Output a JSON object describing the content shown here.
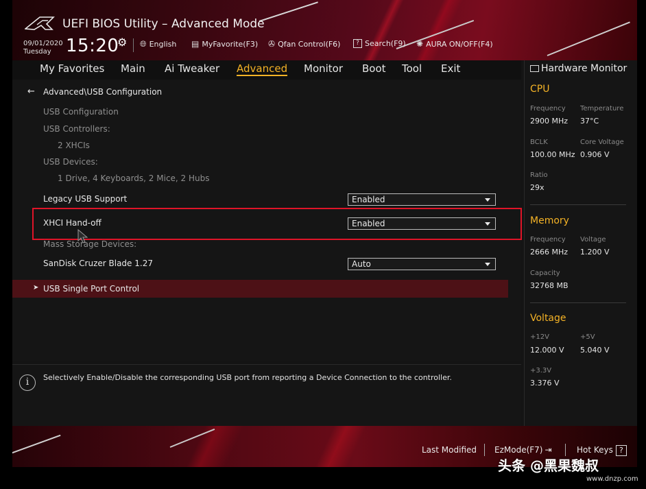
{
  "header": {
    "title": "UEFI BIOS Utility – Advanced Mode",
    "date": "09/01/2020",
    "day": "Tuesday",
    "time": "15:20",
    "tools": {
      "language": "English",
      "myfavorite": "MyFavorite(F3)",
      "qfan": "Qfan Control(F6)",
      "search": "Search(F9)",
      "aura": "AURA ON/OFF(F4)"
    }
  },
  "menu": {
    "favorites": "My Favorites",
    "main": "Main",
    "ai_tweaker": "Ai Tweaker",
    "advanced": "Advanced",
    "monitor": "Monitor",
    "boot": "Boot",
    "tool": "Tool",
    "exit": "Exit"
  },
  "content": {
    "breadcrumb": "Advanced\\USB Configuration",
    "usb_configuration": "USB Configuration",
    "usb_controllers_label": "USB Controllers:",
    "usb_controllers_value": "2 XHCIs",
    "usb_devices_label": "USB Devices:",
    "usb_devices_value": "1 Drive, 4 Keyboards, 2 Mice, 2 Hubs",
    "legacy_label": "Legacy USB Support",
    "legacy_value": "Enabled",
    "xhci_label": "XHCI Hand-off",
    "xhci_value": "Enabled",
    "mass_storage_label": "Mass Storage Devices:",
    "sandisk_label": "SanDisk Cruzer Blade 1.27",
    "sandisk_value": "Auto",
    "single_port_label": "USB Single Port Control"
  },
  "help": {
    "text": "Selectively Enable/Disable the corresponding USB port from reporting a Device Connection to the controller."
  },
  "hw_monitor": {
    "title": "Hardware Monitor",
    "cpu": {
      "heading": "CPU",
      "frequency_label": "Frequency",
      "frequency": "2900 MHz",
      "temperature_label": "Temperature",
      "temperature": "37°C",
      "bclk_label": "BCLK",
      "bclk": "100.00 MHz",
      "core_voltage_label": "Core Voltage",
      "core_voltage": "0.906 V",
      "ratio_label": "Ratio",
      "ratio": "29x"
    },
    "memory": {
      "heading": "Memory",
      "frequency_label": "Frequency",
      "frequency": "2666 MHz",
      "voltage_label": "Voltage",
      "voltage": "1.200 V",
      "capacity_label": "Capacity",
      "capacity": "32768 MB"
    },
    "voltage": {
      "heading": "Voltage",
      "v12_label": "+12V",
      "v12": "12.000 V",
      "v5_label": "+5V",
      "v5": "5.040 V",
      "v33_label": "+3.3V",
      "v33": "3.376 V"
    }
  },
  "footer": {
    "last_modified": "Last Modified",
    "ezmode": "EzMode(F7)",
    "hotkeys": "Hot Keys",
    "hotkeys_key": "?"
  },
  "watermark": {
    "text": "头条 @黑果魏叔",
    "url": "www.dnzp.com"
  },
  "colors": {
    "accent": "#f5b326",
    "highlight_box": "#e01428",
    "selected_row": "#4d1116"
  }
}
